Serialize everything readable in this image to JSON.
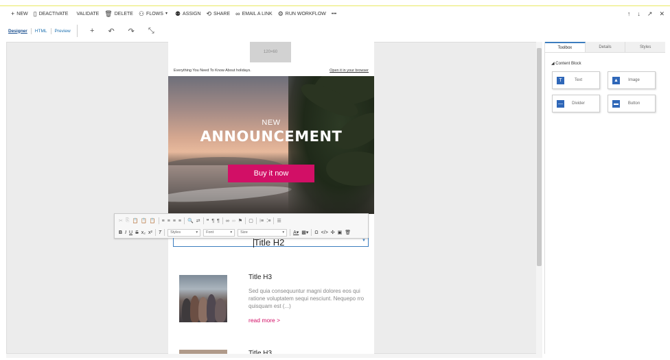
{
  "commandbar": {
    "new": "NEW",
    "deactivate": "DEACTIVATE",
    "validate": "VALIDATE",
    "delete": "DELETE",
    "flows": "FLOWS",
    "assign": "ASSIGN",
    "share": "SHARE",
    "email_link": "EMAIL A LINK",
    "run_workflow": "RUN WORKFLOW",
    "more": "•••"
  },
  "editor_tabs": {
    "designer": "Designer",
    "html": "HTML",
    "preview": "Preview"
  },
  "email": {
    "logo_placeholder": "120×60",
    "preheader": "Everything You Need To Know About holidays.",
    "open_browser": "Open it in your browser",
    "hero_subtitle": "NEW",
    "hero_title": "ANNOUNCEMENT",
    "cta": "Buy it now",
    "title_h2": "Title H2",
    "article": {
      "title": "Title H3",
      "body": "Sed quia consequuntur magni dolores eos qui ratione voluptatem sequi nesciunt. Nequepo rro quisquam est (...)",
      "read_more": "read more >"
    },
    "next_title": "Title H3"
  },
  "rte": {
    "styles": "Styles",
    "font": "Font",
    "size": "Size"
  },
  "panel": {
    "tabs": [
      "Toolbox",
      "Details",
      "Styles"
    ],
    "section": "Content Block",
    "tools": {
      "text": "Text",
      "image": "Image",
      "divider": "Divider",
      "button": "Button"
    }
  },
  "colors": {
    "cta": "#d20f66",
    "accent": "#2f67b8"
  }
}
